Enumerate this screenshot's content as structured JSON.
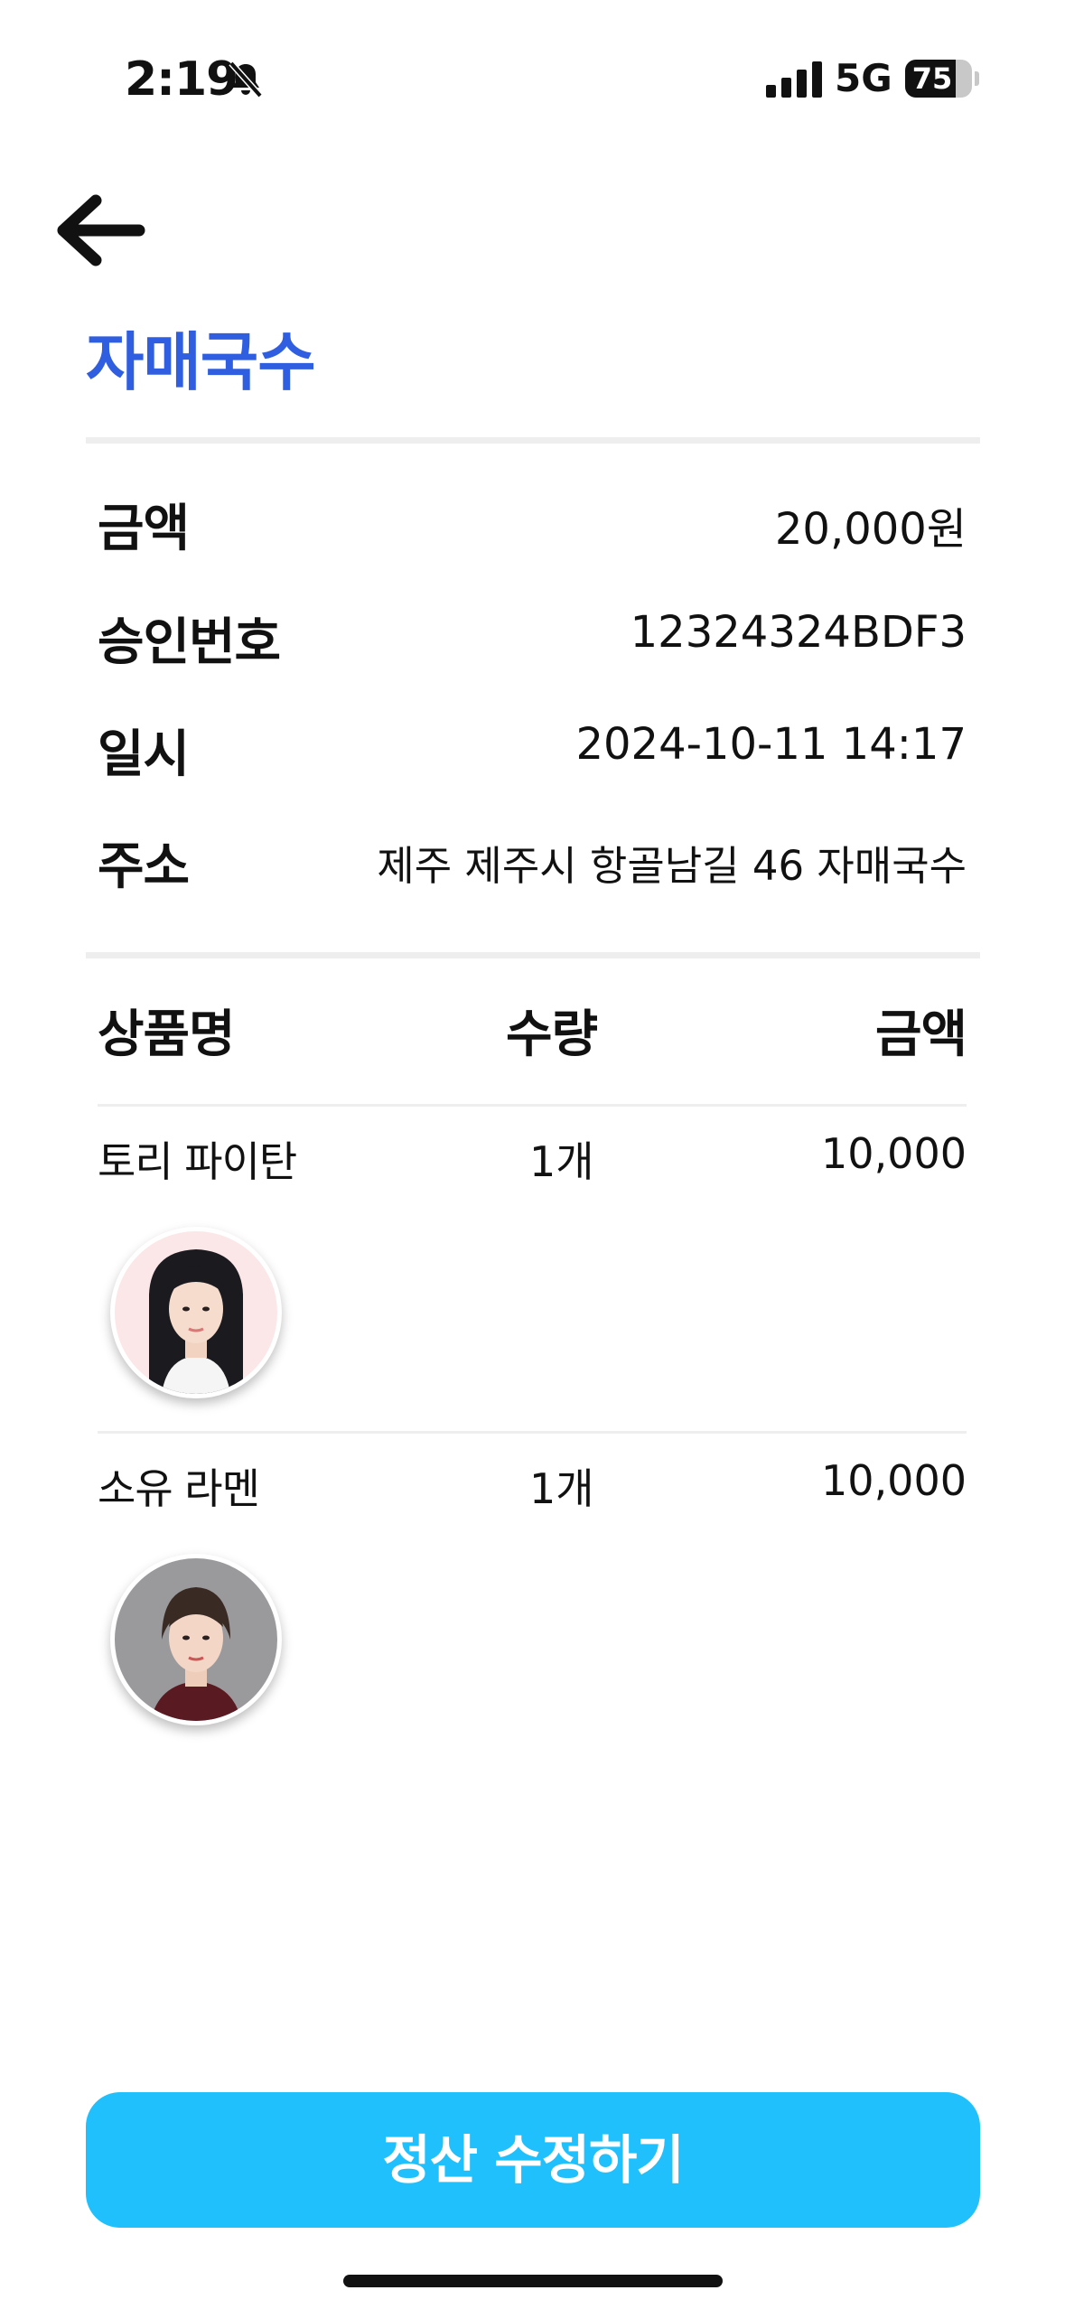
{
  "status_bar": {
    "time": "2:19",
    "network": "5G",
    "battery_percent": "75",
    "battery_level": 0.75,
    "mute_icon": "bell-slash-icon",
    "signal_icon": "cellular-signal-icon"
  },
  "header": {
    "back_icon": "arrow-left-icon",
    "store_name": "자매국수",
    "title_color": "#2f5fe0"
  },
  "details": {
    "amount_label": "금액",
    "amount_value": "20,000원",
    "approval_label": "승인번호",
    "approval_value": "12324324BDF3",
    "datetime_label": "일시",
    "datetime_value": "2024-10-11 14:17",
    "address_label": "주소",
    "address_value": "제주 제주시 항골남길 46 자매국수"
  },
  "items_table": {
    "headers": {
      "name": "상품명",
      "quantity": "수량",
      "amount": "금액"
    },
    "rows": [
      {
        "name": "토리 파이탄",
        "quantity": "1개",
        "amount": "10,000",
        "avatar": "person-photo"
      },
      {
        "name": "소유 라멘",
        "quantity": "1개",
        "amount": "10,000",
        "avatar": "person-photo"
      }
    ]
  },
  "footer": {
    "edit_button_label": "정산 수정하기",
    "button_color": "#1fc0fb"
  }
}
